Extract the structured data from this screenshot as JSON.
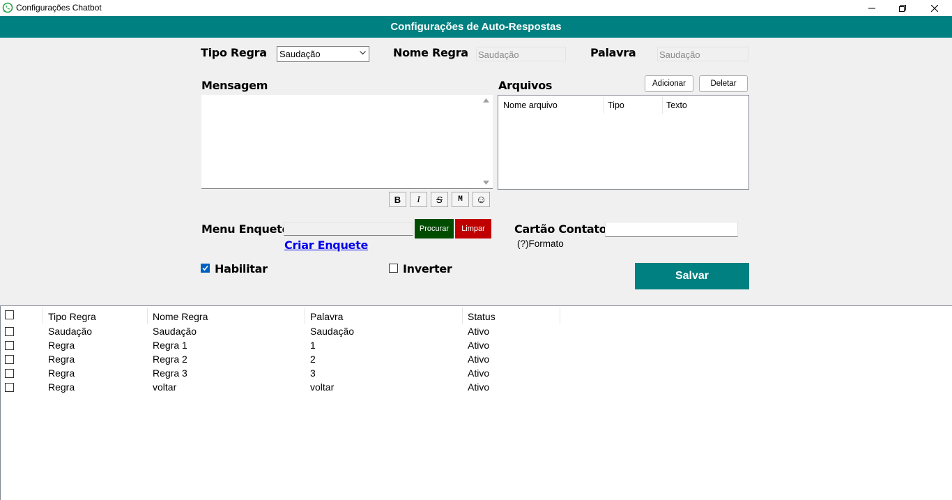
{
  "window": {
    "title": "Configurações Chatbot",
    "header": "Configurações de Auto-Respostas"
  },
  "form": {
    "tipo_regra_label": "Tipo Regra",
    "tipo_regra_value": "Saudação",
    "nome_regra_label": "Nome Regra",
    "nome_regra_value": "Saudação",
    "palavra_label": "Palavra",
    "palavra_value": "Saudação",
    "mensagem_label": "Mensagem",
    "mensagem_value": "",
    "format_buttons": [
      "B",
      "I",
      "S",
      "M",
      "☺"
    ],
    "arquivos_label": "Arquivos",
    "adicionar_label": "Adicionar",
    "deletar_label": "Deletar",
    "arquivos_columns": [
      "Nome arquivo",
      "Tipo",
      "Texto"
    ],
    "menu_enquete_label": "Menu Enquete",
    "menu_enquete_value": "",
    "procurar_label": "Procurar",
    "limpar_label": "Limpar",
    "criar_enquete_label": "Criar Enquete",
    "cartao_contato_label": "Cartão Contato",
    "cartao_contato_value": "",
    "formato_hint": "(?)Formato",
    "habilitar_label": "Habilitar",
    "habilitar_checked": true,
    "inverter_label": "Inverter",
    "inverter_checked": false,
    "salvar_label": "Salvar"
  },
  "colors": {
    "accent": "#008080",
    "procurar": "#004d00",
    "limpar": "#c00000",
    "link": "#0000ee"
  },
  "table": {
    "columns": [
      "Tipo Regra",
      "Nome Regra",
      "Palavra",
      "Status"
    ],
    "rows": [
      {
        "checked": false,
        "tipo": "Saudação",
        "nome": "Saudação",
        "palavra": "Saudação",
        "status": "Ativo"
      },
      {
        "checked": false,
        "tipo": "Regra",
        "nome": "Regra 1",
        "palavra": "1",
        "status": "Ativo"
      },
      {
        "checked": false,
        "tipo": "Regra",
        "nome": "Regra 2",
        "palavra": "2",
        "status": "Ativo"
      },
      {
        "checked": false,
        "tipo": "Regra",
        "nome": "Regra 3",
        "palavra": "3",
        "status": "Ativo"
      },
      {
        "checked": false,
        "tipo": "Regra",
        "nome": "voltar",
        "palavra": "voltar",
        "status": "Ativo"
      }
    ]
  }
}
